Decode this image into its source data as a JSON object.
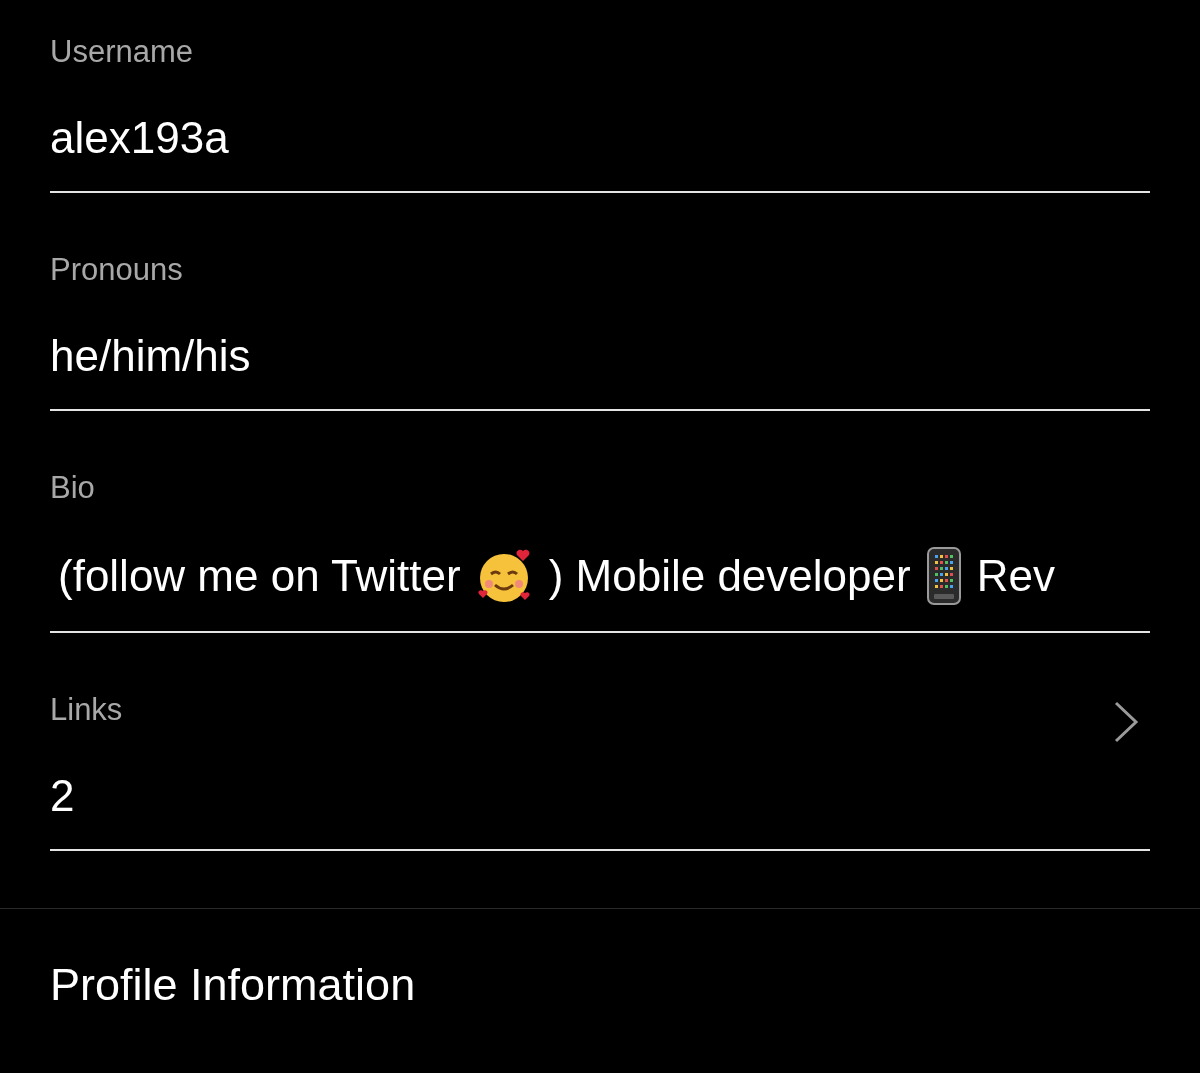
{
  "fields": [
    {
      "kind": "text",
      "label": "Username",
      "value": "alex193a"
    },
    {
      "kind": "text",
      "label": "Pronouns",
      "value": "he/him/his"
    },
    {
      "kind": "rich",
      "label": "Bio",
      "parts": [
        {
          "kind": "text",
          "text": "(follow me on Twitter"
        },
        {
          "kind": "smiley"
        },
        {
          "kind": "text",
          "text": ") Mobile developer"
        },
        {
          "kind": "phone"
        },
        {
          "kind": "text",
          "text": "Rev"
        }
      ]
    },
    {
      "kind": "link",
      "label": "Links",
      "value": "2"
    }
  ],
  "section_title": "Profile Information"
}
